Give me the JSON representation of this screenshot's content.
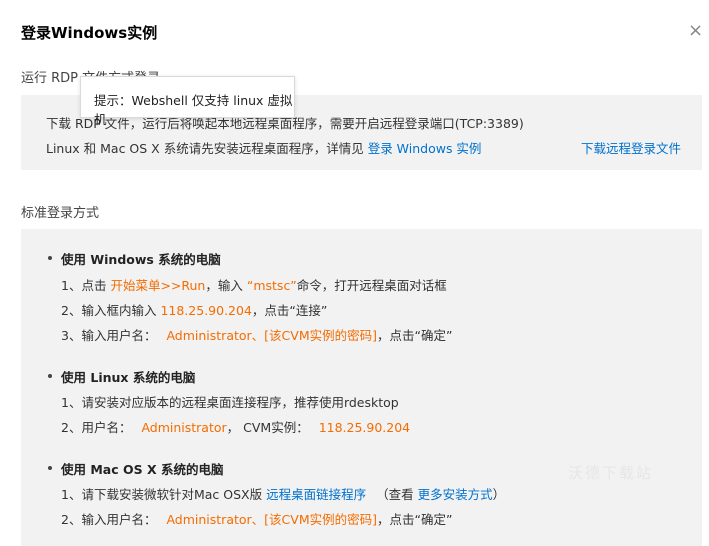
{
  "dialog": {
    "title": "登录Windows实例",
    "close_glyph": "×"
  },
  "rdp": {
    "section_title": "运行 RDP 文件方式登录",
    "line1": "下载 RDP 文件，运行后将唤起本地远程桌面程序，需要开启远程登录端口(TCP:3389)",
    "line2_prefix": "Linux 和 Mac OS X 系统请先安装远程桌面程序，详情见",
    "line2_link": "登录 Windows 实例",
    "download_link": "下载远程登录文件"
  },
  "tooltip": {
    "text": "提示：Webshell 仅支持 linux 虚拟机"
  },
  "standard": {
    "section_title": "标准登录方式",
    "windows": {
      "heading": "使用 Windows 系统的电脑",
      "s1_prefix": "1、点击",
      "s1_menu": "开始菜单>>Run",
      "s1_mid": "，输入",
      "s1_cmd": "“mstsc”",
      "s1_suffix": "命令，打开远程桌面对话框",
      "s2_prefix": "2、输入框内输入",
      "s2_ip": "118.25.90.204",
      "s2_suffix": "，点击“连接”",
      "s3_prefix": "3、输入用户名：",
      "s3_creds": "Administrator、[该CVM实例的密码]",
      "s3_suffix": "，点击“确定”"
    },
    "linux": {
      "heading": "使用 Linux 系统的电脑",
      "s1": "1、请安装对应版本的远程桌面连接程序，推荐使用rdesktop",
      "s2_prefix": "2、用户名：",
      "s2_user": "Administrator",
      "s2_mid": "，  CVM实例：",
      "s2_ip": "118.25.90.204"
    },
    "mac": {
      "heading": "使用 Mac OS X 系统的电脑",
      "s1_prefix": "1、请下载安装微软针对Mac OSX版",
      "s1_link": "远程桌面链接程序",
      "s1_mid": "（查看",
      "s1_link2": "更多安装方式",
      "s1_suffix": "）",
      "s2_prefix": "2、输入用户名：",
      "s2_creds": "Administrator、[该CVM实例的密码]",
      "s2_suffix": "，点击“确定”"
    }
  },
  "watermark": "沃德下载站"
}
